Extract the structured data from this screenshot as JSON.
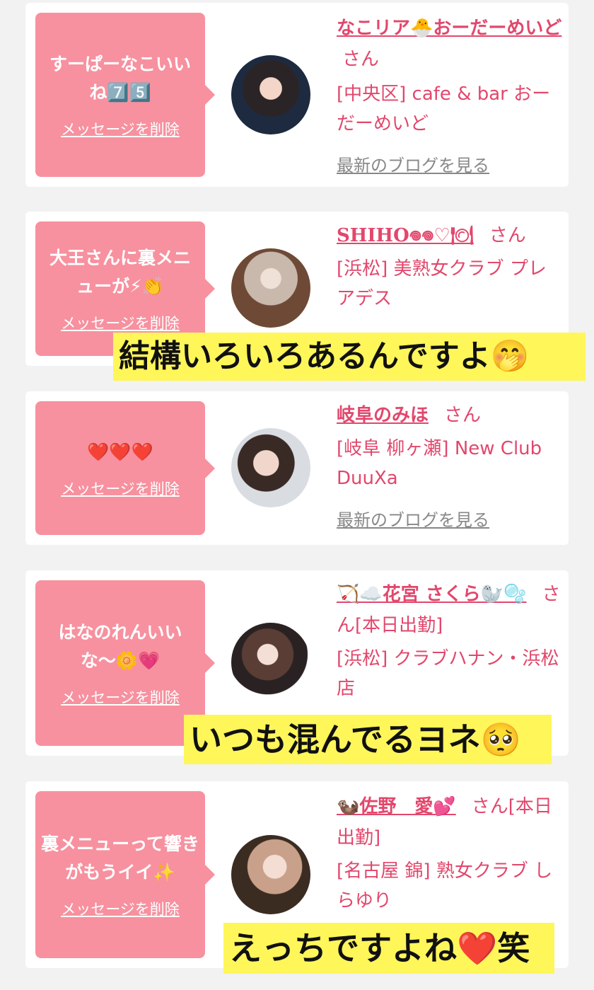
{
  "cards": [
    {
      "message": "すーぱーなこいいね7️⃣5️⃣",
      "delete_label": "メッセージを削除",
      "name": "なこリア🐣おーだーめいど",
      "honorific": "さん",
      "status": "",
      "shop": "[中央区] cafe & bar おーだーめいど",
      "blog_label": "最新のブログを見る"
    },
    {
      "message": "大王さんに裏メニューが⚡👏",
      "delete_label": "メッセージを削除",
      "name": "SHIHO𖦹𖦹♡🍽",
      "honorific": "さん",
      "status": "",
      "shop": "[浜松] 美熟女クラブ プレアデス",
      "blog_label": ""
    },
    {
      "message": "❤️❤️❤️",
      "delete_label": "メッセージを削除",
      "name": "岐阜のみほ",
      "honorific": "さん",
      "status": "",
      "shop": "[岐阜 柳ヶ瀬] New Club DuuXa",
      "blog_label": "最新のブログを見る"
    },
    {
      "message": "はなのれんいいな〜🌼💗",
      "delete_label": "メッセージを削除",
      "name": "🏹☁️花宮 さくら🦭🫧",
      "honorific": "さん",
      "status": "[本日出勤]",
      "shop": "[浜松] クラブハナン・浜松店",
      "blog_label": ""
    },
    {
      "message": "裏メニューって響きがもうイイ✨",
      "delete_label": "メッセージを削除",
      "name": "🦦佐野　愛💕",
      "honorific": "さん",
      "status": "[本日出勤]",
      "shop": "[名古屋 錦] 熟女クラブ しらゆり",
      "blog_label": ""
    }
  ],
  "captions": {
    "c1": "結構いろいろあるんですよ🤭",
    "c2": "いつも混んでるヨネ🥺",
    "c3": "えっちですよね❤️笑"
  },
  "colors": {
    "bubble": "#f7919f",
    "accent": "#e2476c",
    "caption_bg": "#fff65a"
  }
}
